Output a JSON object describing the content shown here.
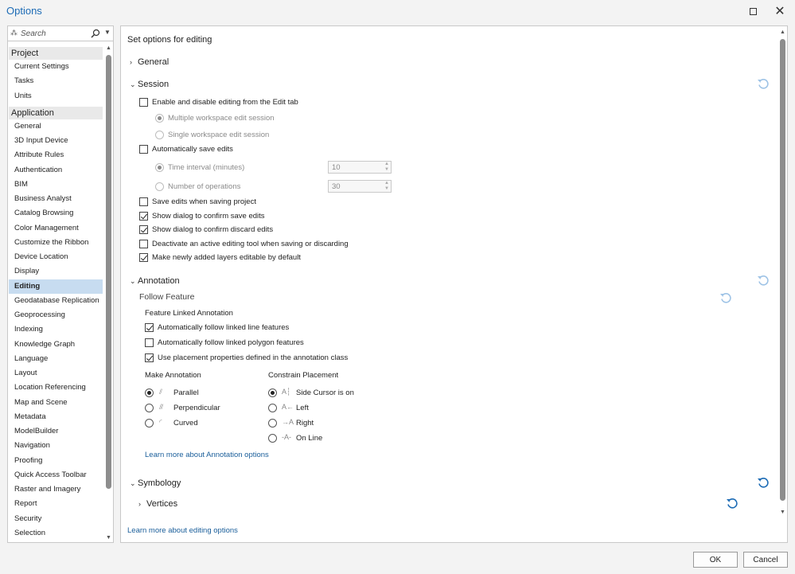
{
  "window": {
    "title": "Options"
  },
  "search": {
    "placeholder": "Search"
  },
  "nav": {
    "project_header": "Project",
    "project_items": [
      "Current Settings",
      "Tasks",
      "Units"
    ],
    "application_header": "Application",
    "application_items": [
      "General",
      "3D Input Device",
      "Attribute Rules",
      "Authentication",
      "BIM",
      "Business Analyst",
      "Catalog Browsing",
      "Color Management",
      "Customize the Ribbon",
      "Device Location",
      "Display",
      "Editing",
      "Geodatabase Replication",
      "Geoprocessing",
      "Indexing",
      "Knowledge Graph",
      "Language",
      "Layout",
      "Location Referencing",
      "Map and Scene",
      "Metadata",
      "ModelBuilder",
      "Navigation",
      "Proofing",
      "Quick Access Toolbar",
      "Raster and Imagery",
      "Report",
      "Security",
      "Selection"
    ],
    "selected": "Editing"
  },
  "main": {
    "title": "Set options for editing",
    "general_label": "General",
    "session": {
      "label": "Session",
      "enable_disable": "Enable and disable editing from the Edit tab",
      "multiple_ws": "Multiple workspace edit session",
      "single_ws": "Single workspace edit session",
      "auto_save": "Automatically save edits",
      "time_interval": "Time interval (minutes)",
      "time_interval_value": "10",
      "num_ops": "Number of operations",
      "num_ops_value": "30",
      "save_with_project": "Save edits when saving project",
      "confirm_save": "Show dialog to confirm save edits",
      "confirm_discard": "Show dialog to confirm discard edits",
      "deactivate_tool": "Deactivate an active editing tool when saving or discarding",
      "layers_editable": "Make newly added layers editable by default"
    },
    "annotation": {
      "label": "Annotation",
      "follow_feature": "Follow Feature",
      "feature_linked": "Feature Linked Annotation",
      "follow_line": "Automatically follow linked line features",
      "follow_polygon": "Automatically follow linked polygon features",
      "use_placement": "Use placement properties defined in the annotation class",
      "make_annotation": "Make Annotation",
      "parallel": "Parallel",
      "perpendicular": "Perpendicular",
      "curved": "Curved",
      "constrain_placement": "Constrain Placement",
      "side_cursor": "Side Cursor is on",
      "left": "Left",
      "right": "Right",
      "on_line": "On Line",
      "learn_more": "Learn more about Annotation options"
    },
    "symbology": {
      "label": "Symbology",
      "vertices": "Vertices"
    },
    "learn_more_editing": "Learn more about editing options"
  },
  "buttons": {
    "ok": "OK",
    "cancel": "Cancel"
  },
  "colors": {
    "accent": "#1c6bb5",
    "selected_bg": "#c7dcf0",
    "link": "#1a5e9a"
  }
}
